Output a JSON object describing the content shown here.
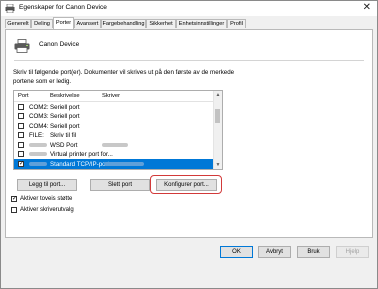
{
  "window": {
    "title": "Egenskaper for Canon Device"
  },
  "tabs": [
    "Generelt",
    "Deling",
    "Porter",
    "Avansert",
    "Fargebehandling",
    "Sikkerhet",
    "Enhetsinnstillinger",
    "Profil"
  ],
  "active_tab": "Porter",
  "device": {
    "name": "Canon Device"
  },
  "description": "Skriv til følgende port(er). Dokumenter vil skrives ut på den første av de merkede portene som er ledig.",
  "ports_list": {
    "headers": {
      "port": "Port",
      "beskrivelse": "Beskrivelse",
      "skriver": "Skriver"
    },
    "rows": [
      {
        "port": "COM2:",
        "beskrivelse": "Seriell port",
        "skriver": "",
        "checked": false,
        "selected": false
      },
      {
        "port": "COM3:",
        "beskrivelse": "Seriell port",
        "skriver": "",
        "checked": false,
        "selected": false
      },
      {
        "port": "COM4:",
        "beskrivelse": "Seriell port",
        "skriver": "",
        "checked": false,
        "selected": false
      },
      {
        "port": "FILE:",
        "beskrivelse": "Skriv til fil",
        "skriver": "",
        "checked": false,
        "selected": false
      },
      {
        "port": "",
        "beskrivelse": "WSD Port",
        "skriver": "",
        "checked": false,
        "selected": false
      },
      {
        "port": "",
        "beskrivelse": "Virtual printer port for...",
        "skriver": "",
        "checked": false,
        "selected": false
      },
      {
        "port": "",
        "beskrivelse": "Standard TCP/IP-port",
        "skriver": "",
        "checked": true,
        "selected": true
      }
    ]
  },
  "buttons": {
    "add_port": "Legg til port...",
    "delete_port": "Slett port",
    "configure_port": "Konfigurer port..."
  },
  "options": {
    "bidirectional": {
      "label": "Aktiver toveis støtte",
      "checked": true
    },
    "pooling": {
      "label": "Aktiver skriverutvalg",
      "checked": false
    }
  },
  "footer": {
    "ok": "OK",
    "cancel": "Avbryt",
    "apply": "Bruk",
    "help": "Hjelp"
  },
  "colors": {
    "selection": "#0078d7",
    "highlight": "#d23a3a"
  }
}
